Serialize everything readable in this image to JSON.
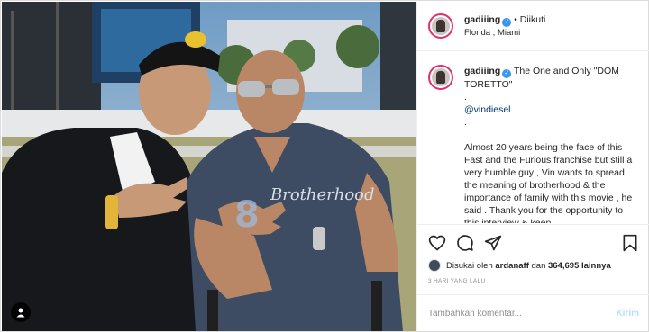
{
  "header": {
    "username": "gadiiing",
    "separator": "•",
    "follow_status": "Diikuti",
    "location": "Florida , Miami"
  },
  "caption": {
    "username": "gadiiing",
    "lines": [
      "The One and Only \"DOM TORETTO\"",
      ".",
      "@vindiesel",
      ".",
      "Almost 20 years being the face of this Fast and the Furious franchise but still a very humble guy , Vin wants to spread the meaning of brotherhood & the importance of family with this movie , he said . Thank you for the opportunity to this interview & keep"
    ]
  },
  "photo": {
    "shirt_text": "Brotherhood",
    "shirt_number": "8"
  },
  "icons": [
    "heart-icon",
    "comment-icon",
    "share-icon",
    "bookmark-icon",
    "user-tag-icon",
    "verified-icon"
  ],
  "likes": {
    "prefix": "Disukai oleh",
    "user": "ardanaff",
    "conjunction": "dan",
    "count": "364,695",
    "suffix": "lainnya"
  },
  "timestamp": "3 HARI YANG LALU",
  "comment_box": {
    "placeholder": "Tambahkan komentar...",
    "post_label": "Kirim"
  },
  "colors": {
    "accent": "#3897f0",
    "post_disabled": "#b2dffc",
    "story_ring": "#e1306c"
  }
}
